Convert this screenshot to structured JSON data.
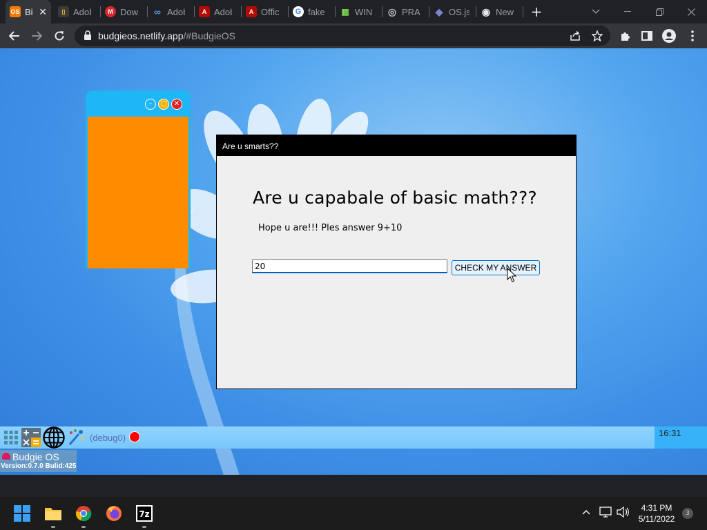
{
  "browser": {
    "tabs": [
      {
        "label": "Bi",
        "icon": "budgie-os-icon",
        "color": "#f57c00",
        "glyph": "OS"
      },
      {
        "label": "Adob",
        "icon": "adobe-file-icon",
        "color": "#3a3a3a",
        "glyph": "▯"
      },
      {
        "label": "Dow",
        "icon": "mega-icon",
        "color": "#d9272e",
        "glyph": "M"
      },
      {
        "label": "Adob",
        "icon": "link-icon",
        "color": "#35363a",
        "glyph": "∞"
      },
      {
        "label": "Adob",
        "icon": "adobe-acrobat-icon",
        "color": "#b30b00",
        "glyph": "A"
      },
      {
        "label": "Offic",
        "icon": "adobe-acrobat-icon",
        "color": "#b30b00",
        "glyph": "A"
      },
      {
        "label": "fake",
        "icon": "google-icon",
        "color": "#ffffff",
        "glyph": "G"
      },
      {
        "label": "WIN",
        "icon": "windows-pixel-icon",
        "color": "#35363a",
        "glyph": "▦"
      },
      {
        "label": "PRAN",
        "icon": "globe-icon",
        "color": "#35363a",
        "glyph": "◎"
      },
      {
        "label": "OS.js",
        "icon": "osjs-cube-icon",
        "color": "#5c6bc0",
        "glyph": "◆"
      },
      {
        "label": "New",
        "icon": "chrome-icon",
        "color": "#35363a",
        "glyph": "◉"
      }
    ],
    "active_tab_close": "✕",
    "new_tab": "+",
    "url_host": "budgieos.netlify.app",
    "url_path": "/#BudgieOS"
  },
  "dialog": {
    "title": "Are u smarts??",
    "heading": "Are u capabale of basic math???",
    "prompt": "Hope u are!!! Ples answer 9+10",
    "answer_value": "20",
    "check_button": "CHECK MY ANSWER"
  },
  "budgie": {
    "os_name": "Budgie OS",
    "version_line": "Version:0.7.0  Bulid:425",
    "debug_label": "(debug0)",
    "clock": "16:31"
  },
  "windows_taskbar": {
    "time": "4:31 PM",
    "date": "5/11/2022",
    "notification_count": "3"
  }
}
